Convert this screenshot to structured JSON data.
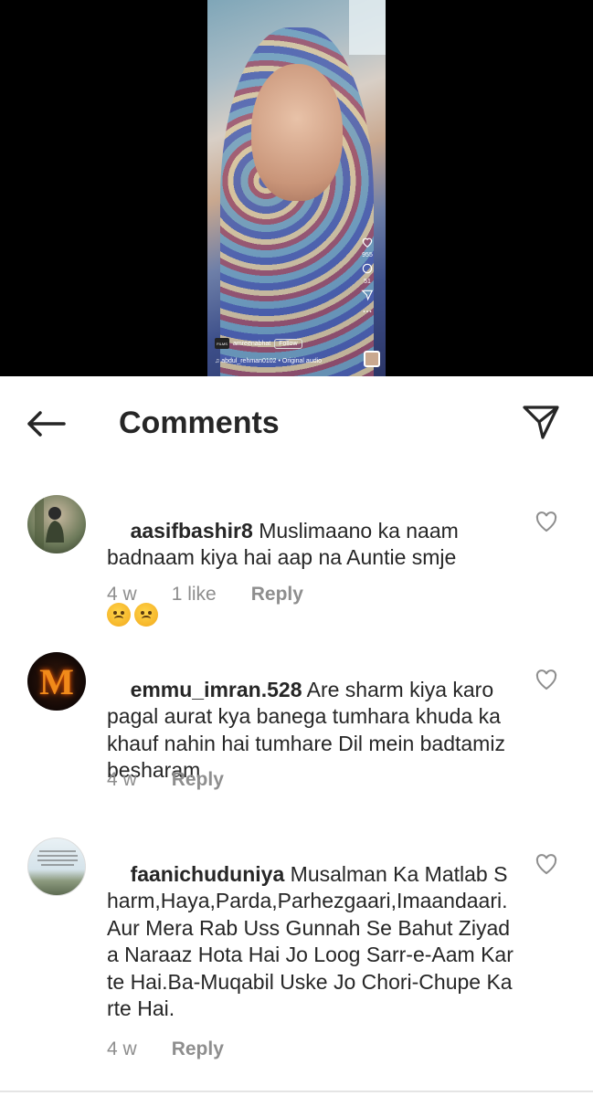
{
  "video": {
    "username": "amreenabhat",
    "follow_label": "Follow",
    "audio": "abdul_rehman0102 • Original audio",
    "like_count": "955",
    "comment_count": "51",
    "logo_text": "FILMS"
  },
  "header": {
    "title": "Comments"
  },
  "comments": [
    {
      "username": "aasifbashir8",
      "text": "Muslimaano ka naam badnaam kiya hai aap na Auntie smje",
      "time": "4 w",
      "likes": "1 like",
      "reply": "Reply"
    },
    {
      "username": "emmu_imran.528",
      "text": "Are sharm kiya karo pagal aurat kya banega tumhara khuda ka khauf nahin hai tumhare Dil mein badtamiz besharam",
      "time": "4 w",
      "reply": "Reply"
    },
    {
      "username": "faanichuduniya",
      "text": "Musalman Ka Matlab Sharm,Haya,Parda,Parhezgaari,Imaandaari.\nAur Mera Rab Uss Gunnah Se Bahut Ziyada Naraaz Hota Hai Jo Loog Sarr-e-Aam Karte Hai.Ba-Muqabil Uske Jo Chori-Chupe Karte Hai.",
      "time": "4 w",
      "reply": "Reply"
    }
  ],
  "avatars": {
    "second_letter": "M"
  }
}
